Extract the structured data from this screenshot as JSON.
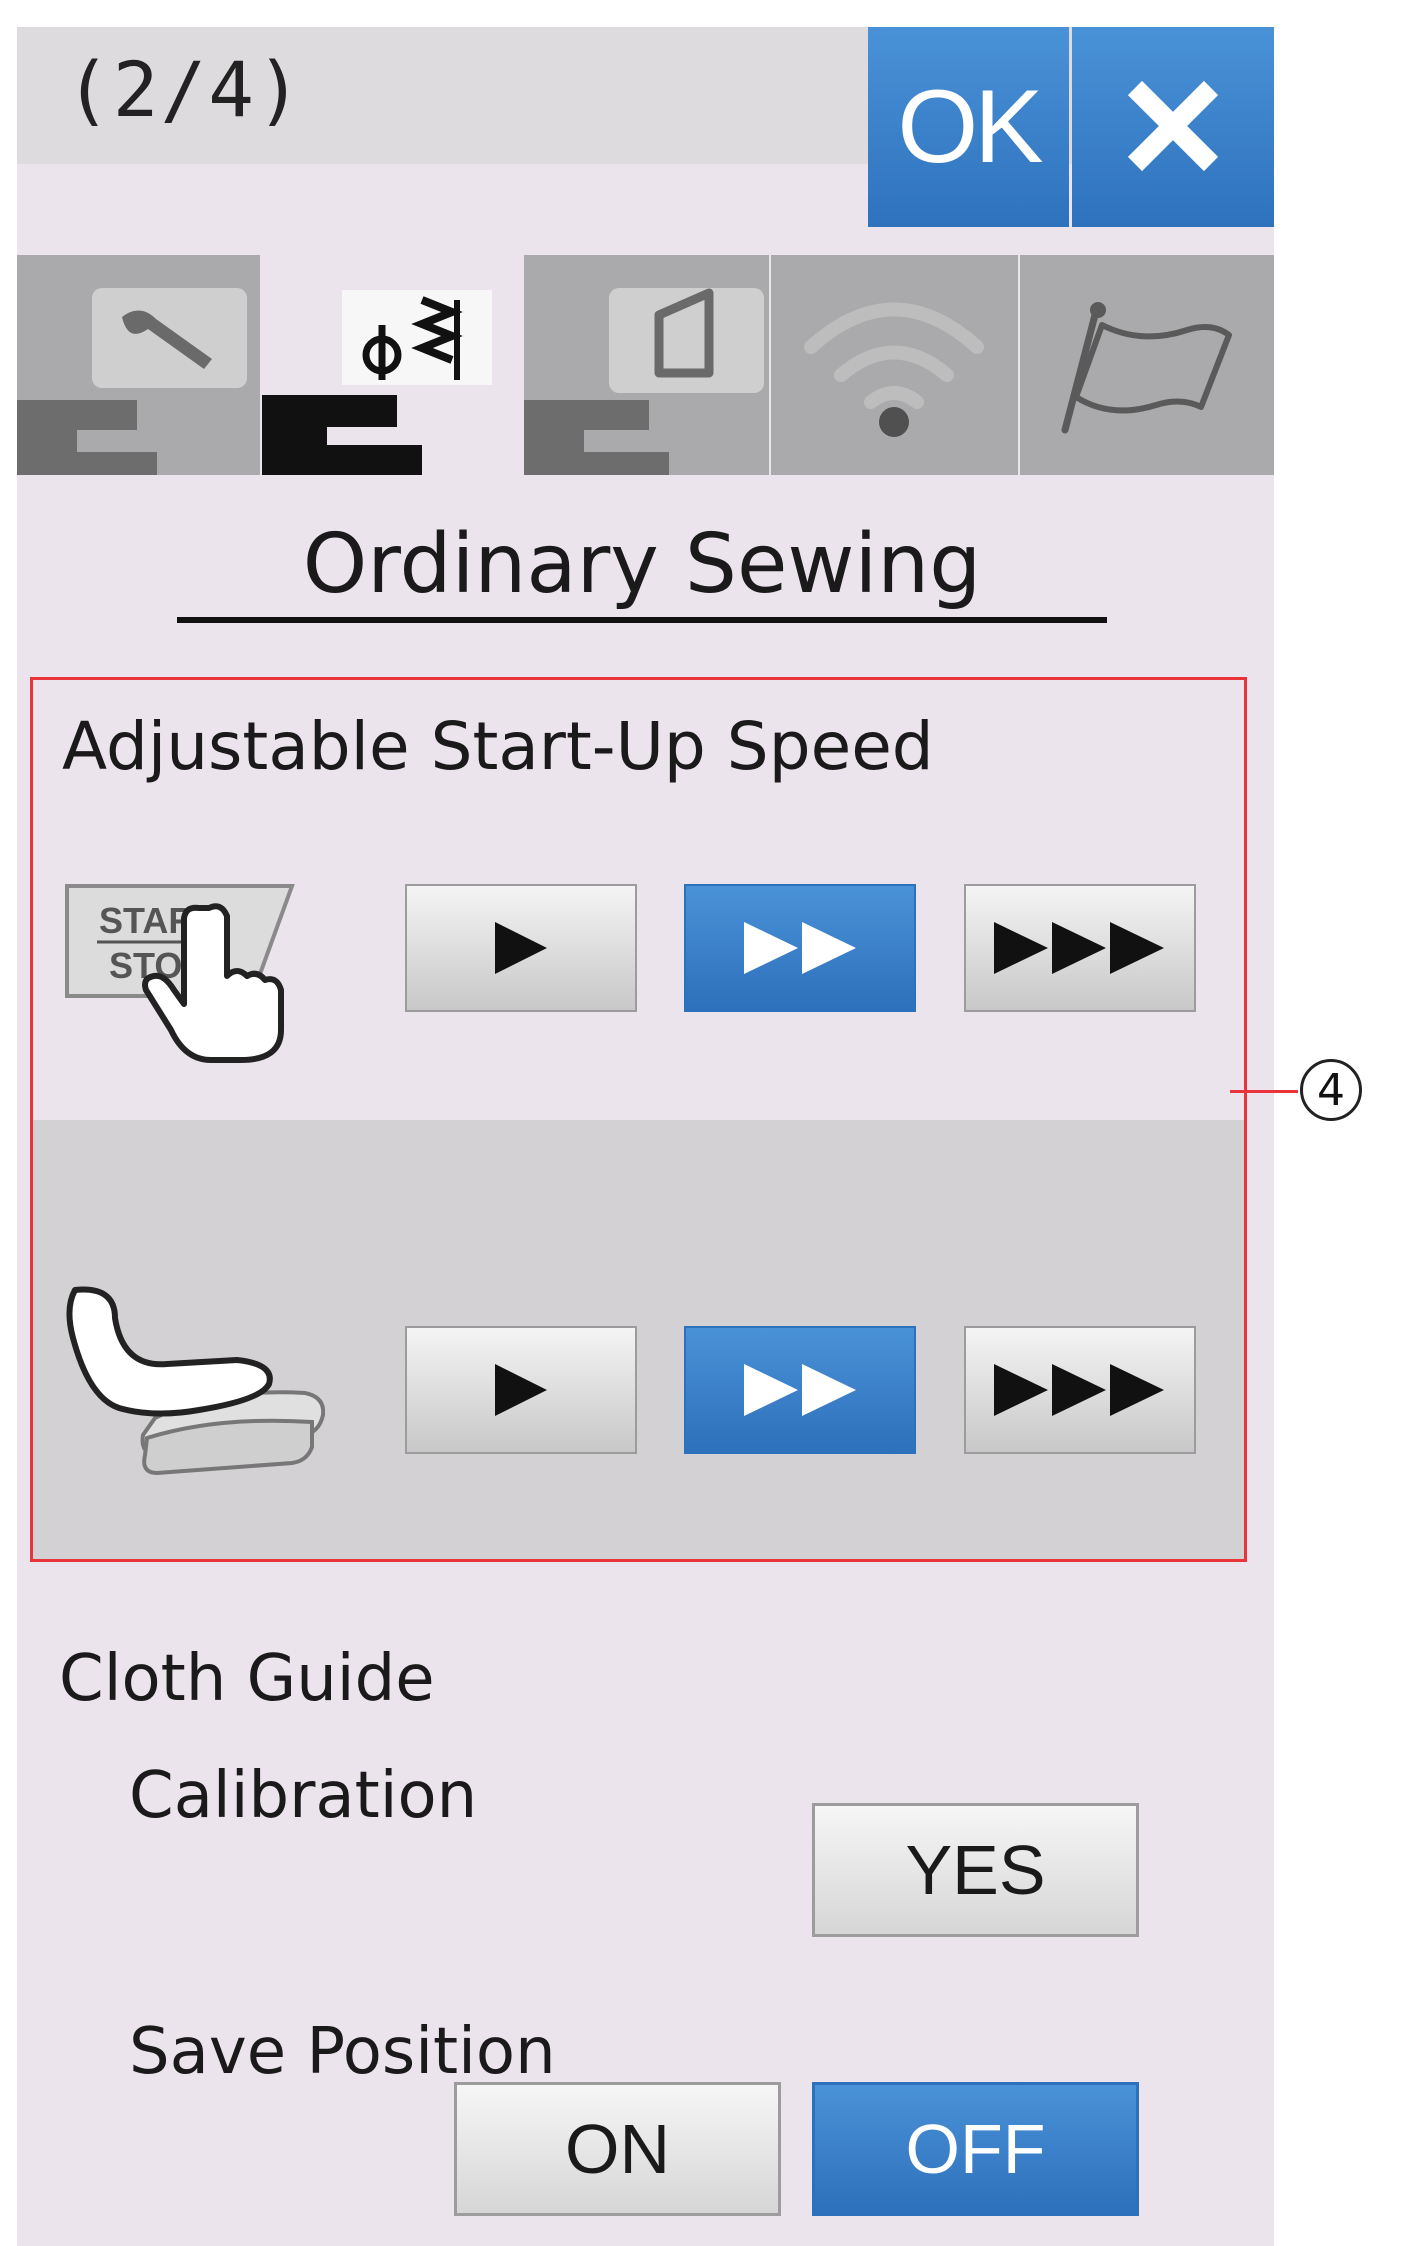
{
  "header": {
    "page_indicator": "(2/4)",
    "ok_label": "OK",
    "close_icon": "close-icon"
  },
  "tabs": [
    {
      "icon": "machine-wrench-icon",
      "active": false
    },
    {
      "icon": "machine-stitch-icon",
      "active": true
    },
    {
      "icon": "machine-hoop-icon",
      "active": false
    },
    {
      "icon": "wifi-icon",
      "active": false
    },
    {
      "icon": "flag-icon",
      "active": false
    }
  ],
  "section": {
    "title": "Ordinary Sewing"
  },
  "startup_speed": {
    "label": "Adjustable Start-Up Speed",
    "start_stop_icon_text": [
      "START",
      "STOP"
    ],
    "start_stop_selected": "medium",
    "foot_control_selected": "medium",
    "options": [
      "slow",
      "medium",
      "fast"
    ]
  },
  "callout": {
    "number": "4",
    "color": "#e8343a"
  },
  "cloth_guide": {
    "label": "Cloth Guide",
    "calibration_label": "Calibration",
    "yes_label": "YES",
    "save_position_label": "Save Position",
    "on_label": "ON",
    "off_label": "OFF",
    "save_position_value": "OFF"
  },
  "colors": {
    "accent": "#2e72bd",
    "background": "#ece4ec",
    "inactive_tab": "#aaa9ac"
  }
}
